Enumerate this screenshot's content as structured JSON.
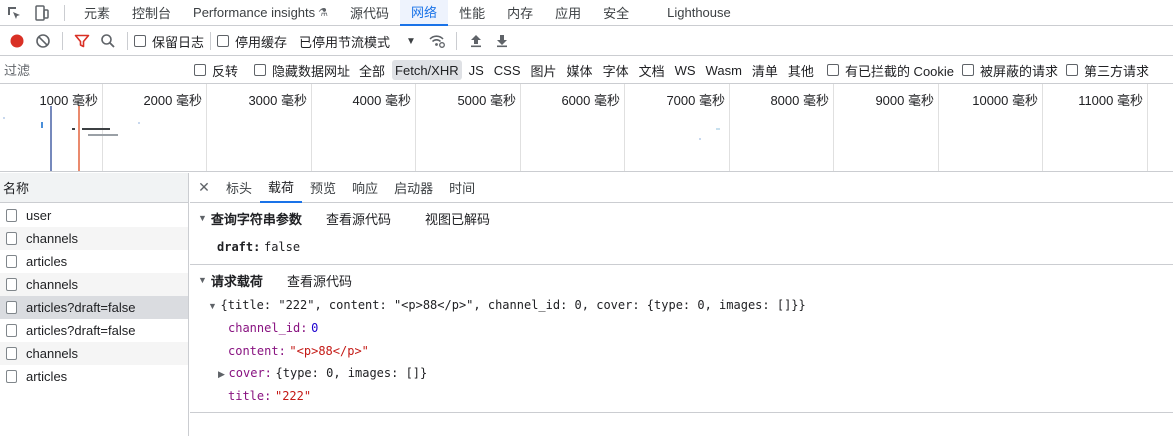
{
  "top_tabs": [
    {
      "label": "元素",
      "active": false
    },
    {
      "label": "控制台",
      "active": false
    },
    {
      "label": "Performance insights",
      "active": false
    },
    {
      "label": "源代码",
      "active": false
    },
    {
      "label": "网络",
      "active": true
    },
    {
      "label": "性能",
      "active": false
    },
    {
      "label": "内存",
      "active": false
    },
    {
      "label": "应用",
      "active": false
    },
    {
      "label": "安全",
      "active": false
    },
    {
      "label": "Lighthouse",
      "active": false
    }
  ],
  "toolbar": {
    "preserve_log": "保留日志",
    "disable_cache": "停用缓存",
    "throttle": "已停用节流模式"
  },
  "filter": {
    "placeholder": "过滤",
    "invert": "反转",
    "hide_data_urls": "隐藏数据网址",
    "types": [
      "全部",
      "Fetch/XHR",
      "JS",
      "CSS",
      "图片",
      "媒体",
      "字体",
      "文档",
      "WS",
      "Wasm",
      "清单",
      "其他"
    ],
    "active_type": "Fetch/XHR",
    "blocked_cookies": "有已拦截的 Cookie",
    "blocked_requests": "被屏蔽的请求",
    "third_party": "第三方请求"
  },
  "timeline": {
    "ticks": [
      "1000 毫秒",
      "2000 毫秒",
      "3000 毫秒",
      "4000 毫秒",
      "5000 毫秒",
      "6000 毫秒",
      "7000 毫秒",
      "8000 毫秒",
      "9000 毫秒",
      "10000 毫秒",
      "11000 毫秒"
    ]
  },
  "requests": {
    "header": "名称",
    "items": [
      "user",
      "channels",
      "articles",
      "channels",
      "articles?draft=false",
      "articles?draft=false",
      "channels",
      "articles"
    ],
    "selected_index": 4
  },
  "detail": {
    "tabs": [
      "标头",
      "载荷",
      "预览",
      "响应",
      "启动器",
      "时间"
    ],
    "active_tab": "载荷",
    "query": {
      "title": "查询字符串参数",
      "view_source": "查看源代码",
      "view_decoded": "视图已解码",
      "key": "draft:",
      "value": "false"
    },
    "payload": {
      "title": "请求载荷",
      "view_source": "查看源代码",
      "summary": "{title: \"222\", content: \"<p>88</p>\", channel_id: 0, cover: {type: 0, images: []}}",
      "channel_id_key": "channel_id:",
      "channel_id_val": "0",
      "content_key": "content:",
      "content_val": "\"<p>88</p>\"",
      "cover_key": "cover:",
      "cover_val": "{type: 0, images: []}",
      "title_key": "title:",
      "title_val": "\"222\""
    }
  },
  "colors": {
    "accent": "#1a73e8",
    "record": "#d93025",
    "filter_icon": "#d93025"
  }
}
